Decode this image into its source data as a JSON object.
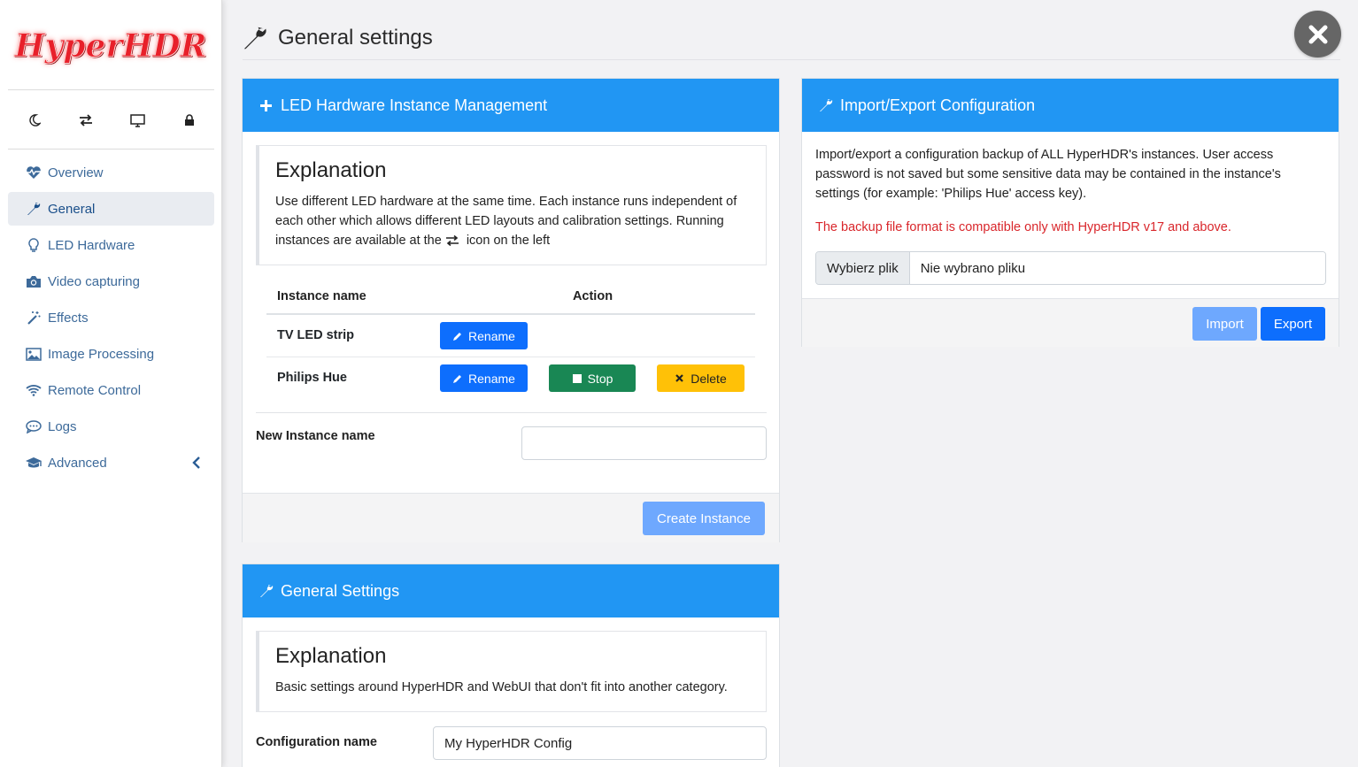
{
  "app": {
    "logo_text": "HyperHDR"
  },
  "quick_icons": [
    {
      "name": "moon-icon"
    },
    {
      "name": "swap-icon"
    },
    {
      "name": "monitor-icon"
    },
    {
      "name": "lock-icon"
    }
  ],
  "sidebar": {
    "items": [
      {
        "label": "Overview",
        "icon": "heartbeat-icon",
        "active": false
      },
      {
        "label": "General",
        "icon": "wrench-icon",
        "active": true
      },
      {
        "label": "LED Hardware",
        "icon": "lightbulb-icon",
        "active": false
      },
      {
        "label": "Video capturing",
        "icon": "camera-icon",
        "active": false
      },
      {
        "label": "Effects",
        "icon": "magic-wand-icon",
        "active": false
      },
      {
        "label": "Image Processing",
        "icon": "image-icon",
        "active": false
      },
      {
        "label": "Remote Control",
        "icon": "wifi-icon",
        "active": false
      },
      {
        "label": "Logs",
        "icon": "chat-icon",
        "active": false
      },
      {
        "label": "Advanced",
        "icon": "graduation-cap-icon",
        "active": false
      }
    ]
  },
  "header": {
    "title": "General settings"
  },
  "instances_panel": {
    "title": "LED Hardware Instance Management",
    "explanation_title": "Explanation",
    "explanation_text_1": "Use different LED hardware at the same time. Each instance runs independent of each other which allows different LED layouts and calibration settings. Running instances are available at the",
    "explanation_text_2": "icon on the left",
    "table": {
      "col_name": "Instance name",
      "col_action": "Action",
      "rows": [
        {
          "name": "TV LED strip",
          "rename": "Rename"
        },
        {
          "name": "Philips Hue",
          "rename": "Rename",
          "stop": "Stop",
          "delete": "Delete"
        }
      ]
    },
    "new_instance_label": "New Instance name",
    "new_instance_value": "",
    "create_button": "Create Instance"
  },
  "general_panel": {
    "title": "General Settings",
    "explanation_title": "Explanation",
    "explanation_text": "Basic settings around HyperHDR and WebUI that don't fit into another category.",
    "config_name_label": "Configuration name",
    "config_name_value": "My HyperHDR Config"
  },
  "import_export_panel": {
    "title": "Import/Export Configuration",
    "description": "Import/export a configuration backup of ALL HyperHDR's instances. User access password is not saved but some sensitive data may be contained in the instance's settings (for example: 'Philips Hue' access key).",
    "warning": "The backup file format is compatible only with HyperHDR v17 and above.",
    "file_button": "Wybierz plik",
    "file_status": "Nie wybrano pliku",
    "import_button": "Import",
    "export_button": "Export"
  },
  "colors": {
    "accent": "#2196f3",
    "primary": "#0d6efd",
    "success": "#198754",
    "warning": "#ffc107",
    "danger_text": "#d9262b",
    "nav_text": "#3d6a9a"
  }
}
